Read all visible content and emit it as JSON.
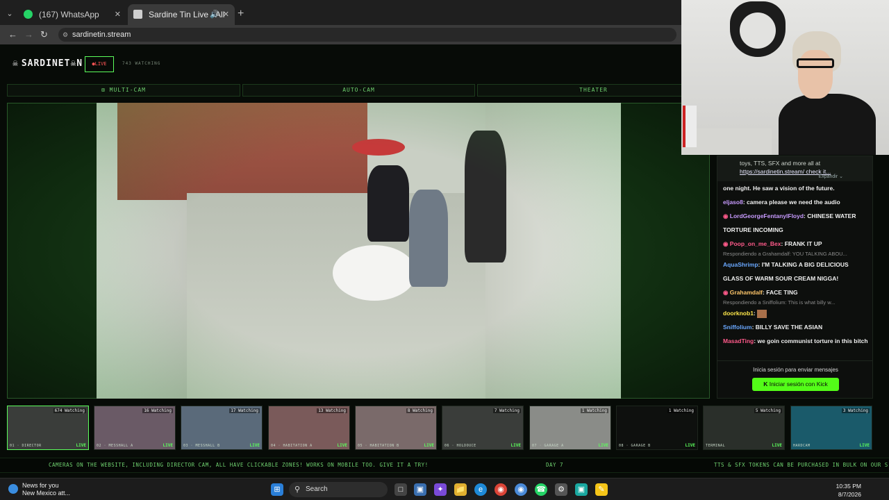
{
  "browser": {
    "tabs": [
      {
        "label": "(167) WhatsApp",
        "favicon_color": "#25d366"
      },
      {
        "label": "Sardine Tin Live - All Room",
        "favicon_color": "#cccccc"
      }
    ],
    "url": "sardinetin.stream"
  },
  "header": {
    "logo": "SARDINET☠N",
    "live_label": "●LIVE",
    "watching": "743 WATCHING"
  },
  "modes": [
    "⊞ MULTI-CAM",
    "AUTO-CAM",
    "THEATER"
  ],
  "chat": {
    "pinned_line": "toys, TTS, SFX and more all at",
    "pinned_link": "https://sardinetin.stream/ check it...",
    "expand": "Expandir ⌄",
    "messages": [
      {
        "user": "",
        "text": "one night. He saw a vision of the future.",
        "color": "#f0f0f0"
      },
      {
        "user": "eljaso8",
        "text": "camera please we need the audio",
        "color": "#c89bff"
      },
      {
        "user": "LordGeorgeFentanylFloyd",
        "text": "CHINESE WATER TORTURE INCOMING",
        "color": "#c89bff"
      },
      {
        "user": "Poop_on_me_Bex",
        "text": "FRANK IT UP",
        "color": "#ff5a8a",
        "reply": "Respondiendo a Grahamdalf: YOU TALKING ABOU..."
      },
      {
        "user": "AquaShrimp",
        "text": "I'M TALKING A BIG DELICIOUS GLASS OF WARM SOUR CREAM NIGGA!",
        "color": "#6aa8ff"
      },
      {
        "user": "Grahamdalf",
        "text": "FACE  TING",
        "color": "#ffc66a",
        "reply": "Respondiendo a Sniffolium: This is what billy w..."
      },
      {
        "user": "doorknob1",
        "text": "",
        "color": "#ffe84a"
      },
      {
        "user": "Sniffolium",
        "text": "BILLY SAVE THE ASIAN",
        "color": "#6aa8ff"
      },
      {
        "user": "MasadTing",
        "text": "we goin communist torture in this bitch",
        "color": "#ff5a8a"
      }
    ],
    "login_hint": "Inicia sesión para enviar mensajes",
    "login_button": "Iniciar sesión con Kick"
  },
  "thumbnails": [
    {
      "name": "01 · DIRECTOR",
      "watching": "674 Watching",
      "live": "LIVE",
      "bg": "#3a3d3a"
    },
    {
      "name": "02 · MESSHALL A",
      "watching": "16 Watching",
      "live": "LIVE",
      "bg": "#6a5a66"
    },
    {
      "name": "03 · MESSHALL B",
      "watching": "17 Watching",
      "live": "LIVE",
      "bg": "#5a6a7a"
    },
    {
      "name": "04 · HABITATION A",
      "watching": "13 Watching",
      "live": "LIVE",
      "bg": "#7a5a5a"
    },
    {
      "name": "05 · HABITATION B",
      "watching": "8 Watching",
      "live": "LIVE",
      "bg": "#7a6a6a"
    },
    {
      "name": "06 · HOLDOUCE",
      "watching": "7 Watching",
      "live": "LIVE",
      "bg": "#3a3d3a"
    },
    {
      "name": "07 · GARAGE A",
      "watching": "1 Watching",
      "live": "LIVE",
      "bg": "#8a8c88"
    },
    {
      "name": "08 · GARAGE B",
      "watching": "1 Watching",
      "live": "LIVE",
      "bg": "#0e100e"
    },
    {
      "name": "TERMINAL",
      "watching": "5 Watching",
      "live": "LIVE",
      "bg": "#2a2f2a"
    },
    {
      "name": "HARDCAM",
      "watching": "3 Watching",
      "live": "LIVE",
      "bg": "#1a5a6a"
    }
  ],
  "ticker": {
    "left": "CAMERAS ON THE WEBSITE, INCLUDING DIRECTOR CAM, ALL HAVE CLICKABLE ZONES! WORKS ON MOBILE TOO. GIVE IT A TRY!",
    "center": "DAY 7",
    "right": "TTS & SFX TOKENS CAN BE PURCHASED IN BULK ON OUR S"
  },
  "taskbar": {
    "news_title": "News for you",
    "news_sub": "New Mexico att...",
    "search": "Search",
    "time": "10:35 PM",
    "date": "8/7/2026"
  }
}
